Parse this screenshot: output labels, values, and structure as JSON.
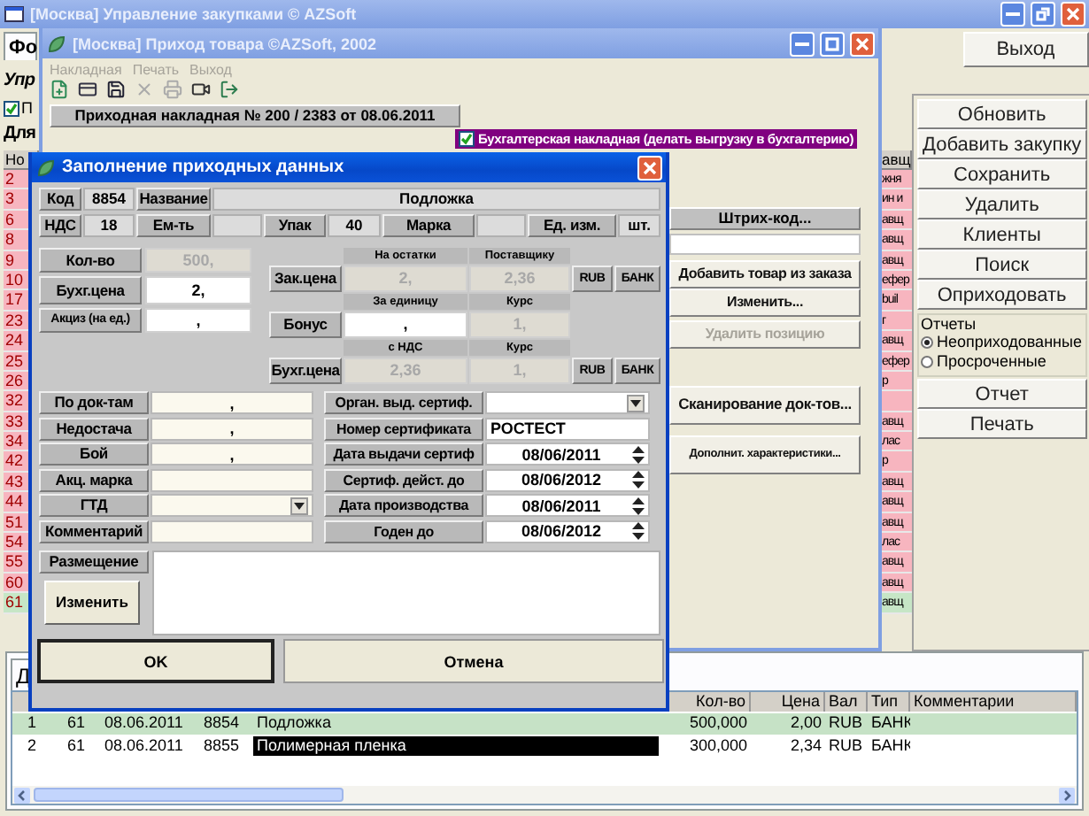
{
  "main_window": {
    "title": "[Москва] Управление закупками   © AZSoft",
    "exit_button": "Выход",
    "tab": "Фо",
    "heading": "Упр",
    "filter_checkbox": {
      "label": "П",
      "checked": true
    },
    "section_label": "Для",
    "list_table": {
      "header": "Но",
      "tail_header": "авщ",
      "rows": [
        {
          "number": "2",
          "tail": "жня",
          "color": "#f7b5bf"
        },
        {
          "number": "3",
          "tail": "ин и",
          "color": "#f7b5bf"
        },
        {
          "number": "6",
          "tail": "авщ",
          "color": "#f7b5bf"
        },
        {
          "number": "8",
          "tail": "авщ",
          "color": "#f7b5bf"
        },
        {
          "number": "9",
          "tail": "авщ",
          "color": "#f7b5bf"
        },
        {
          "number": "10",
          "tail": "ефер",
          "color": "#f7b5bf"
        },
        {
          "number": "17",
          "tail": "buil",
          "color": "#f7b5bf"
        },
        {
          "number": "23",
          "tail": "г",
          "color": "#f7b5bf"
        },
        {
          "number": "24",
          "tail": "авщ",
          "color": "#f7b5bf"
        },
        {
          "number": "25",
          "tail": "ефер",
          "color": "#f7b5bf"
        },
        {
          "number": "26",
          "tail": "р",
          "color": "#f7b5bf"
        },
        {
          "number": "32",
          "color": "#f7b5bf"
        },
        {
          "number": "33",
          "tail": "авщ",
          "color": "#f7b5bf"
        },
        {
          "number": "34",
          "tail": "лас",
          "color": "#f7b5bf"
        },
        {
          "number": "42",
          "tail": "р",
          "color": "#f7b5bf"
        },
        {
          "number": "43",
          "tail": "авщ",
          "color": "#f7b5bf"
        },
        {
          "number": "44",
          "tail": "авщ",
          "color": "#f7b5bf"
        },
        {
          "number": "51",
          "tail": "авщ",
          "color": "#f7b5bf"
        },
        {
          "number": "54",
          "tail": "лас",
          "color": "#f7b5bf"
        },
        {
          "number": "55",
          "tail": "авщ",
          "color": "#f7b5bf"
        },
        {
          "number": "60",
          "tail": "авщ",
          "color": "#f7b5bf"
        },
        {
          "number": "61",
          "tail": "авщ",
          "color": "#c6e6c6"
        }
      ]
    },
    "side_buttons": [
      "Обновить",
      "Добавить закупку",
      "Сохранить",
      "Удалить",
      "Клиенты",
      "Поиск",
      "Оприходовать"
    ],
    "reports": {
      "title": "Отчеты",
      "options": [
        {
          "label": "Неоприходованные",
          "selected": true
        },
        {
          "label": "Просроченные",
          "selected": false
        }
      ]
    },
    "report_buttons": [
      "Отчет",
      "Печать"
    ],
    "details": {
      "tab": "Д",
      "columns": [
        null,
        null,
        null,
        null,
        null,
        "Кол-во",
        "Цена",
        "Вал",
        "Тип",
        "Комментарии"
      ],
      "rows": [
        {
          "cells": [
            "1",
            "61",
            "08.06.2011",
            "8854",
            "Подложка",
            "500,000",
            "2,00",
            "RUB",
            "БАНК"
          ],
          "color": "#c6e2c6",
          "name_selected": false
        },
        {
          "cells": [
            "2",
            "61",
            "08.06.2011",
            "8855",
            "Полимерная пленка",
            "300,000",
            "2,34",
            "RUB",
            "БАНК"
          ],
          "color": "#ffffff",
          "name_selected": true
        }
      ]
    }
  },
  "receipt_window": {
    "title": "[Москва] Приход товара ©AZSoft, 2002",
    "menu": [
      {
        "label": "Накладная",
        "disabled": true
      },
      {
        "label": "Печать",
        "disabled": true
      },
      {
        "label": "Выход",
        "disabled": true
      }
    ],
    "invoice_label": "Приходная накладная № 200 / 2383 от 08.06.2011",
    "accounting_checkbox": {
      "label": "Бухгалтерская накладная (делать выгрузку в бухгалтерию)",
      "checked": true
    },
    "barcode_label": "Штрих-код...",
    "edit_buttons": [
      {
        "label": "Добавить товар из заказа",
        "disabled": false
      },
      {
        "label": "Изменить...",
        "disabled": false
      },
      {
        "label": "Удалить позицию",
        "disabled": true
      }
    ],
    "doc_buttons": [
      {
        "label": "Сканирование док-тов...",
        "disabled": false
      },
      {
        "label": "Дополнит. характеристики...",
        "disabled": false
      }
    ]
  },
  "entry_dialog": {
    "title": "Заполнение приходных данных",
    "header_rows": [
      [
        {
          "kind": "label",
          "text": "Код"
        },
        {
          "kind": "value",
          "text": "8854"
        },
        {
          "kind": "label",
          "text": "Название"
        },
        {
          "kind": "value",
          "text": "Подложка"
        }
      ],
      [
        {
          "kind": "label",
          "text": "НДС"
        },
        {
          "kind": "value",
          "text": "18"
        },
        {
          "kind": "label",
          "text": "Ем-ть"
        },
        {
          "kind": "value"
        },
        {
          "kind": "label",
          "text": "Упак"
        },
        {
          "kind": "value",
          "text": "40"
        },
        {
          "kind": "label",
          "text": "Марка"
        },
        {
          "kind": "value"
        },
        {
          "kind": "label",
          "text": "Ед. изм."
        },
        {
          "kind": "value",
          "text": "шт."
        }
      ]
    ],
    "quantity_fields": [
      {
        "label": "Кол-во",
        "value": "500,",
        "disabled": true
      },
      {
        "label": "Бухг.цена",
        "value": "2,",
        "disabled": false
      },
      {
        "label": "Акциз (на ед.)",
        "value": ",",
        "disabled": false
      }
    ],
    "price_grid": [
      {
        "kind": "header",
        "cells": [
          "На остатки",
          "Поставщику"
        ]
      },
      {
        "kind": "row",
        "label": "Зак.цена",
        "fields": [
          {
            "value": "2,",
            "disabled": true
          },
          {
            "value": "2,36",
            "disabled": true
          }
        ],
        "currency": "RUB",
        "payment": "БАНК"
      },
      {
        "kind": "header",
        "cells": [
          "За единицу",
          "Курс"
        ]
      },
      {
        "kind": "row",
        "label": "Бонус",
        "fields": [
          {
            "value": ",",
            "disabled": false
          },
          {
            "value": "1,",
            "disabled": true
          }
        ]
      },
      {
        "kind": "header",
        "cells": [
          "с НДС",
          "Курс"
        ]
      },
      {
        "kind": "row",
        "label": "Бухг.цена",
        "fields": [
          {
            "value": "2,36",
            "disabled": true
          },
          {
            "value": "1,",
            "disabled": true
          }
        ],
        "currency": "RUB",
        "payment": "БАНК"
      }
    ],
    "left_form": [
      {
        "label": "По док-там",
        "kind": "text",
        "value": ","
      },
      {
        "label": "Недостача",
        "kind": "text",
        "value": ","
      },
      {
        "label": "Бой",
        "kind": "text",
        "value": ","
      },
      {
        "label": "Акц. марка",
        "kind": "text"
      },
      {
        "label": "ГТД",
        "kind": "dropdown"
      },
      {
        "label": "Комментарий",
        "kind": "text"
      }
    ],
    "right_form": [
      {
        "label": "Орган. выд. сертиф.",
        "kind": "dropdown"
      },
      {
        "label": "Номер сертификата",
        "kind": "text",
        "value": "РОСТЕСТ"
      },
      {
        "label": "Дата выдачи сертиф",
        "kind": "date",
        "value": "08/06/2011"
      },
      {
        "label": "Сертиф. дейст. до",
        "kind": "date",
        "value": "08/06/2012"
      },
      {
        "label": "Дата производства",
        "kind": "date",
        "value": "08/06/2011"
      },
      {
        "label": "Годен до",
        "kind": "date",
        "value": "08/06/2012"
      }
    ],
    "placement": {
      "label": "Размещение",
      "button": "Изменить"
    },
    "buttons": [
      "OK",
      "Отмена"
    ]
  }
}
